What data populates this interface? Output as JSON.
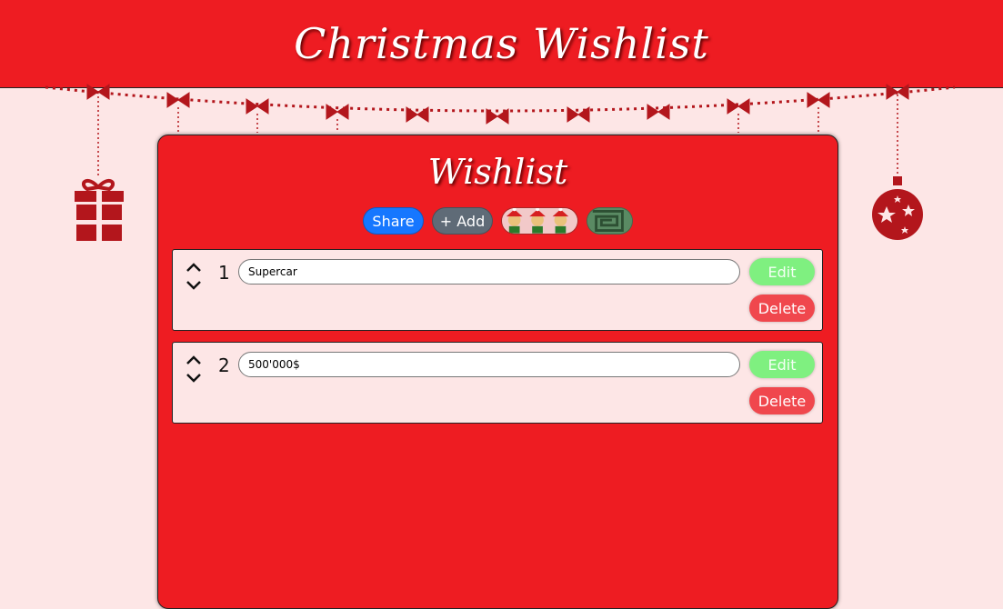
{
  "header": {
    "title": "Christmas Wishlist"
  },
  "panel": {
    "title": "Wishlist",
    "toolbar": {
      "share_label": "Share",
      "add_label": "+ Add"
    }
  },
  "items": [
    {
      "number": "1",
      "value": "Supercar",
      "edit_label": "Edit",
      "delete_label": "Delete"
    },
    {
      "number": "2",
      "value": "500'000$",
      "edit_label": "Edit",
      "delete_label": "Delete"
    }
  ],
  "colors": {
    "header_red": "#ee1c22",
    "background_pink": "#fde6e6",
    "share_blue": "#1677ff",
    "add_gray": "#5f6b77",
    "edit_green": "#7ff080",
    "delete_red": "#f0474d"
  }
}
